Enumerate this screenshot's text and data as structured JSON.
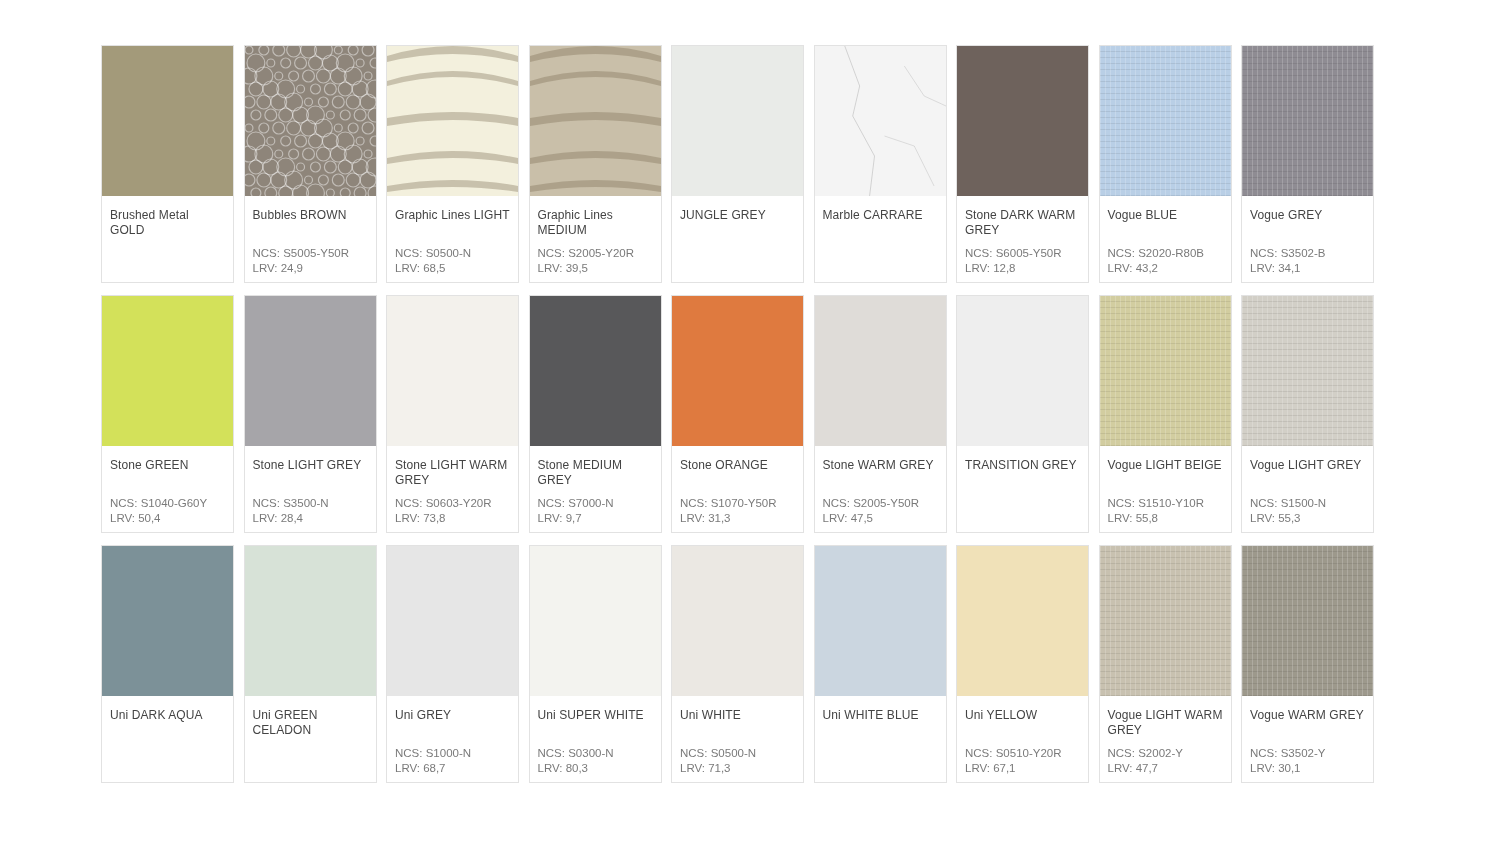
{
  "swatches": [
    {
      "name": "Brushed Metal GOLD",
      "color": "#a39a7a",
      "kind": "plain"
    },
    {
      "name": "Bubbles BROWN",
      "ncs": "NCS: S5005-Y50R",
      "lrv": "LRV: 24,9",
      "color": "#8e857a",
      "kind": "bubbles"
    },
    {
      "name": "Graphic Lines LIGHT",
      "ncs": "NCS: S0500-N",
      "lrv": "LRV: 68,5",
      "color": "#f3f0dd",
      "kind": "waves"
    },
    {
      "name": "Graphic Lines MEDIUM",
      "ncs": "NCS: S2005-Y20R",
      "lrv": "LRV: 39,5",
      "color": "#c9bfa9",
      "kind": "waves"
    },
    {
      "name": "JUNGLE GREY",
      "color": "#e9ebe8",
      "kind": "plain"
    },
    {
      "name": "Marble CARRARE",
      "color": "#f4f4f4",
      "kind": "marble"
    },
    {
      "name": "Stone DARK WARM GREY",
      "ncs": "NCS: S6005-Y50R",
      "lrv": "LRV: 12,8",
      "color": "#6e625c",
      "kind": "plain"
    },
    {
      "name": "Vogue BLUE",
      "ncs": "NCS: S2020-R80B",
      "lrv": "LRV: 43,2",
      "color": "#b9cfe6",
      "kind": "weave"
    },
    {
      "name": "Vogue GREY",
      "ncs": "NCS: S3502-B",
      "lrv": "LRV: 34,1",
      "color": "#8f8c93",
      "kind": "weave"
    },
    {
      "name": "Stone GREEN",
      "ncs": "NCS: S1040-G60Y",
      "lrv": "LRV: 50,4",
      "color": "#d3e15a",
      "kind": "plain"
    },
    {
      "name": "Stone LIGHT GREY",
      "ncs": "NCS: S3500-N",
      "lrv": "LRV: 28,4",
      "color": "#a6a5a9",
      "kind": "plain"
    },
    {
      "name": "Stone LIGHT WARM GREY",
      "ncs": "NCS: S0603-Y20R",
      "lrv": "LRV: 73,8",
      "color": "#f3f1ec",
      "kind": "plain"
    },
    {
      "name": "Stone MEDIUM GREY",
      "ncs": "NCS: S7000-N",
      "lrv": "LRV: 9,7",
      "color": "#58585a",
      "kind": "plain"
    },
    {
      "name": "Stone ORANGE",
      "ncs": "NCS: S1070-Y50R",
      "lrv": "LRV: 31,3",
      "color": "#df7a3f",
      "kind": "plain"
    },
    {
      "name": "Stone WARM GREY",
      "ncs": "NCS: S2005-Y50R",
      "lrv": "LRV: 47,5",
      "color": "#dfdcd8",
      "kind": "plain"
    },
    {
      "name": "TRANSITION GREY",
      "color": "#eeeeee",
      "kind": "plain"
    },
    {
      "name": "Vogue LIGHT BEIGE",
      "ncs": "NCS: S1510-Y10R",
      "lrv": "LRV: 55,8",
      "color": "#d2cda0",
      "kind": "weave"
    },
    {
      "name": "Vogue LIGHT GREY",
      "ncs": "NCS: S1500-N",
      "lrv": "LRV: 55,3",
      "color": "#d2cfc7",
      "kind": "weave"
    },
    {
      "name": "Uni DARK AQUA",
      "color": "#7c9198",
      "kind": "plain"
    },
    {
      "name": "Uni GREEN CELADON",
      "color": "#d7e2d7",
      "kind": "plain"
    },
    {
      "name": "Uni GREY",
      "ncs": "NCS: S1000-N",
      "lrv": "LRV: 68,7",
      "color": "#e6e6e6",
      "kind": "plain"
    },
    {
      "name": "Uni SUPER WHITE",
      "ncs": "NCS: S0300-N",
      "lrv": "LRV: 80,3",
      "color": "#f3f3ef",
      "kind": "plain"
    },
    {
      "name": "Uni WHITE",
      "ncs": "NCS: S0500-N",
      "lrv": "LRV: 71,3",
      "color": "#ebe8e3",
      "kind": "plain"
    },
    {
      "name": "Uni WHITE BLUE",
      "color": "#cbd6e0",
      "kind": "plain"
    },
    {
      "name": "Uni YELLOW",
      "ncs": "NCS: S0510-Y20R",
      "lrv": "LRV: 67,1",
      "color": "#f0e1b8",
      "kind": "plain"
    },
    {
      "name": "Vogue LIGHT WARM GREY",
      "ncs": "NCS: S2002-Y",
      "lrv": "LRV: 47,7",
      "color": "#c8c1b0",
      "kind": "weave"
    },
    {
      "name": "Vogue WARM GREY",
      "ncs": "NCS: S3502-Y",
      "lrv": "LRV: 30,1",
      "color": "#9d998c",
      "kind": "weave"
    }
  ]
}
